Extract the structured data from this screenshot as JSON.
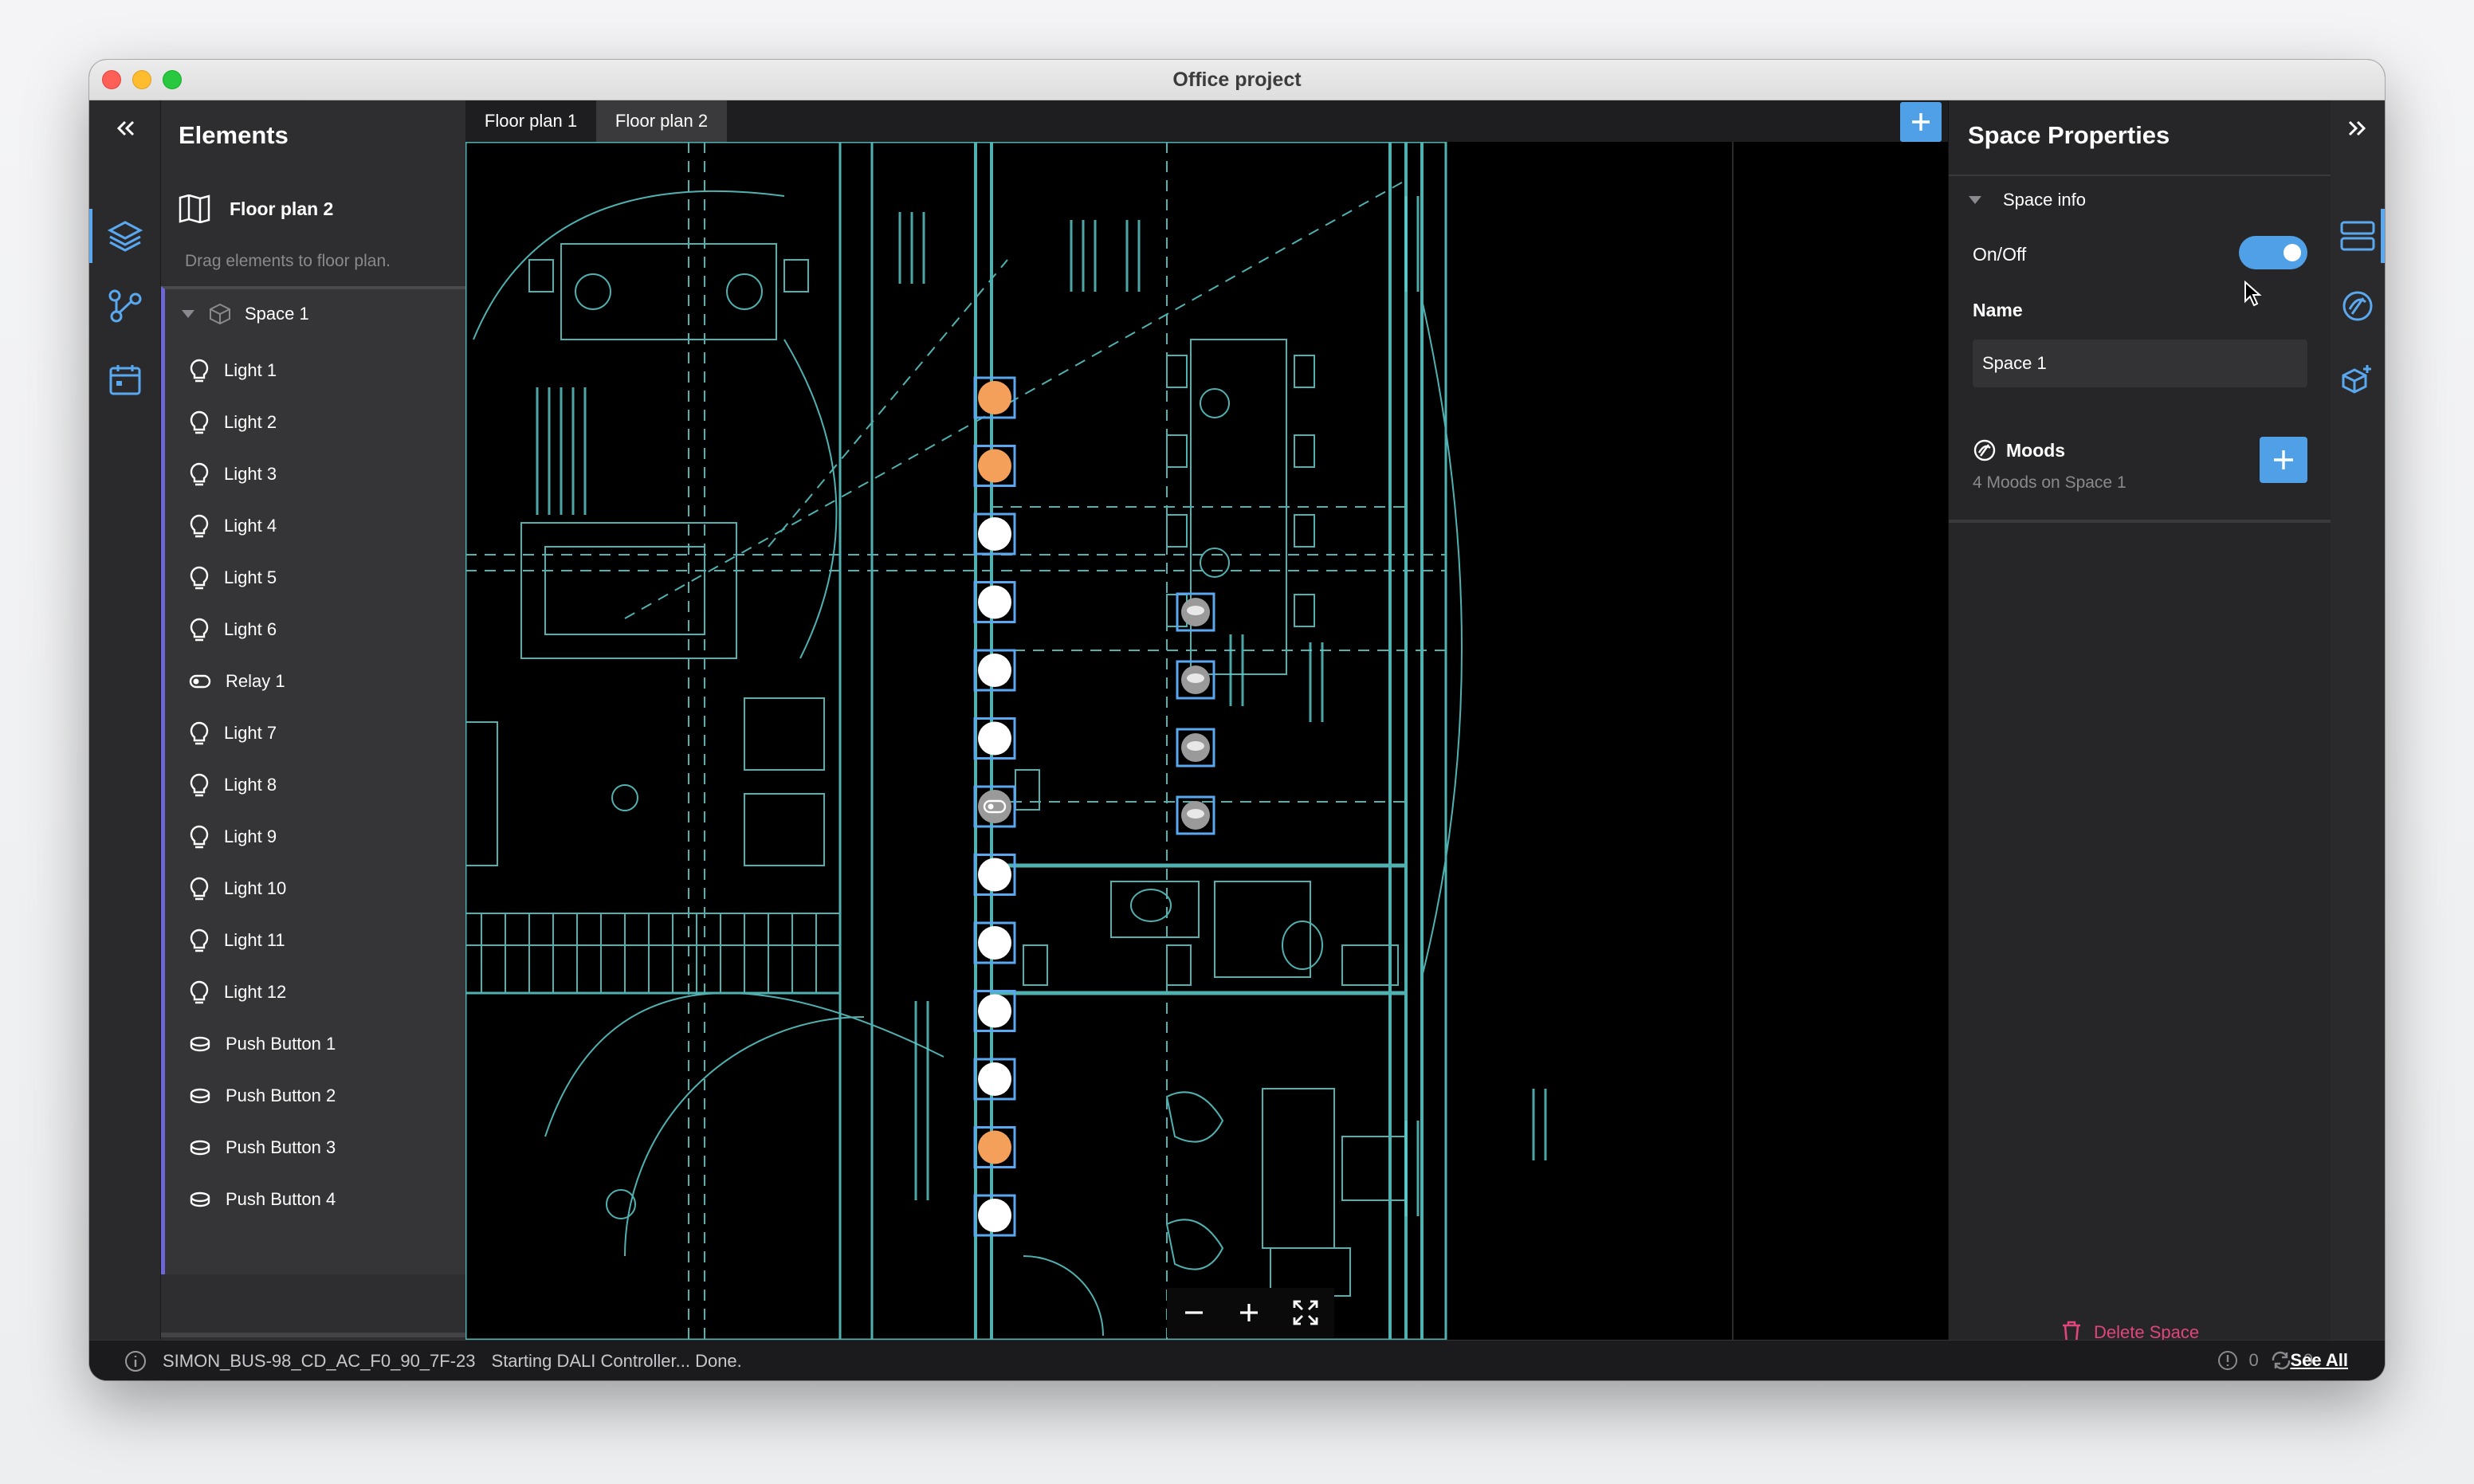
{
  "window": {
    "title": "Office project"
  },
  "left_panel": {
    "collapse_icon": "double-chevron-left-icon",
    "title": "Elements",
    "floor_plan_label": "Floor plan 2",
    "hint": "Drag elements to floor plan.",
    "space_label": "Space 1",
    "items": [
      {
        "label": "Light 1",
        "icon": "bulb-icon"
      },
      {
        "label": "Light 2",
        "icon": "bulb-icon"
      },
      {
        "label": "Light 3",
        "icon": "bulb-icon"
      },
      {
        "label": "Light 4",
        "icon": "bulb-icon"
      },
      {
        "label": "Light 5",
        "icon": "bulb-icon"
      },
      {
        "label": "Light 6",
        "icon": "bulb-icon"
      },
      {
        "label": "Relay 1",
        "icon": "relay-icon"
      },
      {
        "label": "Light 7",
        "icon": "bulb-icon"
      },
      {
        "label": "Light 8",
        "icon": "bulb-icon"
      },
      {
        "label": "Light 9",
        "icon": "bulb-icon"
      },
      {
        "label": "Light 10",
        "icon": "bulb-icon"
      },
      {
        "label": "Light 11",
        "icon": "bulb-icon"
      },
      {
        "label": "Light 12",
        "icon": "bulb-icon"
      },
      {
        "label": "Push Button 1",
        "icon": "push-button-icon"
      },
      {
        "label": "Push Button 2",
        "icon": "push-button-icon"
      },
      {
        "label": "Push Button 3",
        "icon": "push-button-icon"
      },
      {
        "label": "Push Button 4",
        "icon": "push-button-icon"
      }
    ]
  },
  "canvas": {
    "tabs": [
      {
        "label": "Floor plan 1"
      },
      {
        "label": "Floor plan 2"
      }
    ],
    "active_tab": "Floor plan 2",
    "light_markers": [
      "on",
      "on",
      "off",
      "off",
      "off",
      "off",
      "relay",
      "off",
      "off",
      "off",
      "off",
      "on",
      "off"
    ]
  },
  "right_panel": {
    "expand_icon": "double-chevron-right-icon",
    "title": "Space Properties",
    "section_label": "Space info",
    "onoff_label": "On/Off",
    "onoff_value": true,
    "name_label": "Name",
    "name_value": "Space 1",
    "moods_label": "Moods",
    "moods_sub": "4 Moods on Space 1",
    "delete_label": "Delete Space"
  },
  "status_bar": {
    "device": "SIMON_BUS-98_CD_AC_F0_90_7F-23",
    "message": "Starting DALI Controller... Done.",
    "warnings": "0",
    "sync": "0",
    "see_all": "See All"
  },
  "colors": {
    "accent": "#4fa0e6",
    "light_on": "#f4a05a",
    "light_off": "#ffffff",
    "delete": "#e0457b",
    "blueprint": "#5fd0d0",
    "selection": "#6f66d6"
  }
}
